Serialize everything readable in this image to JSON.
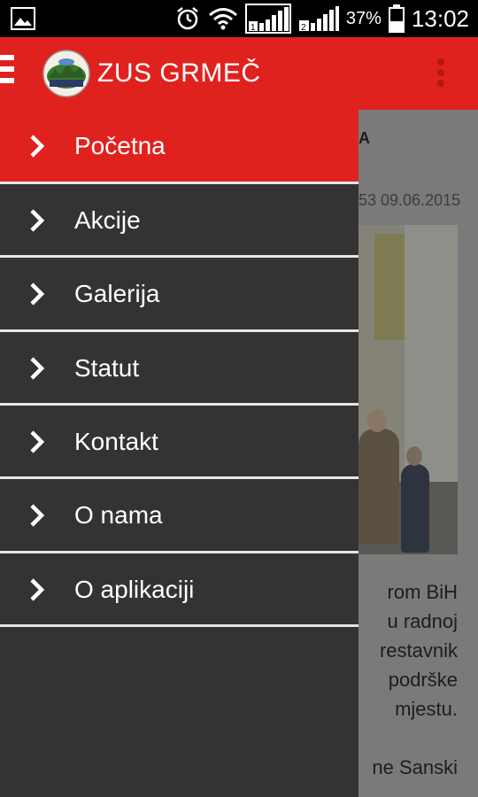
{
  "status_bar": {
    "battery_percent": "37%",
    "time": "13:02",
    "sim1": "1",
    "sim2": "2"
  },
  "app_bar": {
    "title": "ZUS GRMEČ"
  },
  "drawer": {
    "items": [
      {
        "label": "Početna",
        "active": true
      },
      {
        "label": "Akcije",
        "active": false
      },
      {
        "label": "Galerija",
        "active": false
      },
      {
        "label": "Statut",
        "active": false
      },
      {
        "label": "Kontakt",
        "active": false
      },
      {
        "label": "O nama",
        "active": false
      },
      {
        "label": "O aplikaciji",
        "active": false
      }
    ]
  },
  "background_content": {
    "heading_fragment": "A",
    "datetime_fragment": "53 09.06.2015",
    "paragraph_lines": [
      "rom BiH",
      "u radnoj",
      "restavnik",
      "podrške",
      "mjestu.",
      "",
      "ne Sanski"
    ]
  },
  "colors": {
    "accent": "#e0221f",
    "drawer_bg": "#333333",
    "divider": "#e6e6e6"
  }
}
